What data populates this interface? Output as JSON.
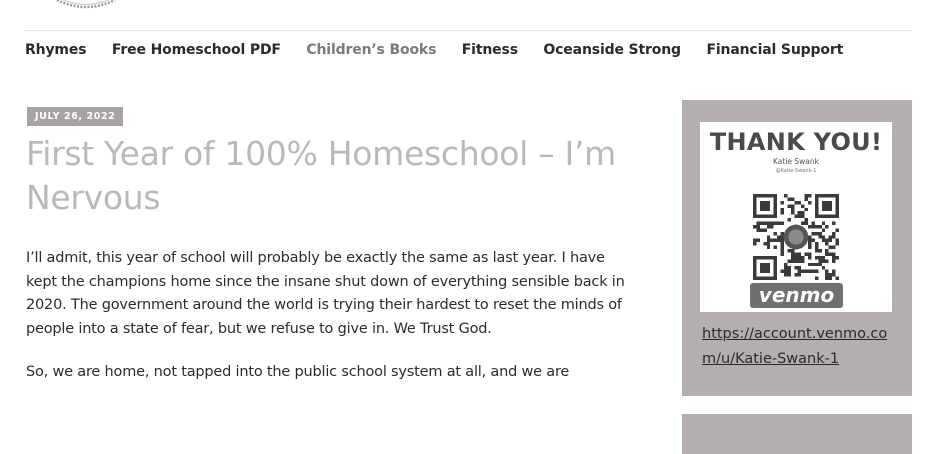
{
  "header": {
    "logo_name": "site-logo"
  },
  "nav": {
    "items": [
      {
        "label": "Rhymes",
        "active": false
      },
      {
        "label": "Free Homeschool PDF",
        "active": false
      },
      {
        "label": "Children’s Books",
        "active": true
      },
      {
        "label": "Fitness",
        "active": false
      },
      {
        "label": "Oceanside Strong",
        "active": false
      },
      {
        "label": "Financial Support",
        "active": false
      }
    ]
  },
  "post": {
    "date": "JULY 26, 2022",
    "title": "First Year of 100% Homeschool – I’m Nervous",
    "paragraphs": [
      "I’ll admit, this year of school will probably be exactly the same as last year. I have kept the champions home since the insane shut down of everything sensible back in 2020. The government around the world is trying their hardest to reset the minds of people into a state of fear, but we refuse to give in. We Trust God.",
      "So, we are home, not tapped into the public school system at all, and we are"
    ]
  },
  "sidebar": {
    "qr_card": {
      "heading": "THANK YOU!",
      "name": "Katie Swank",
      "handle": "@Katie-Swank-1",
      "logo_text": "venmo"
    },
    "link_text": "https://account.venmo.com/u/Katie-Swank-1"
  },
  "colors": {
    "sidebar_bg": "#b4aeaf",
    "date_badge_bg": "#a8a2a3",
    "title_color": "#b9b9b9",
    "nav_active_color": "#7a7a7a"
  }
}
